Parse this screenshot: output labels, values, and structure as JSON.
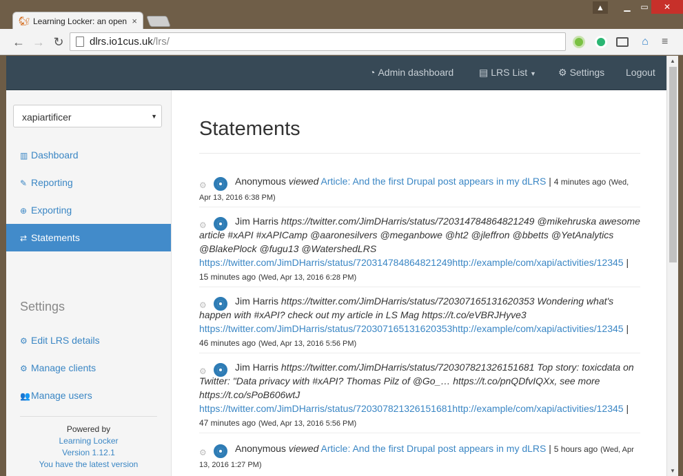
{
  "browser": {
    "tab_title": "Learning Locker: an open",
    "tab_close": "×",
    "url_host": "dlrs.io1cus.uk",
    "url_path": "/lrs/"
  },
  "topnav": {
    "admin": "Admin dashboard",
    "lrs_list": "LRS List",
    "settings": "Settings",
    "logout": "Logout"
  },
  "sidebar": {
    "select_value": "xapiartificer",
    "items": [
      {
        "label": "Dashboard"
      },
      {
        "label": "Reporting"
      },
      {
        "label": "Exporting"
      },
      {
        "label": "Statements"
      }
    ],
    "settings_heading": "Settings",
    "settings_items": [
      {
        "label": "Edit LRS details"
      },
      {
        "label": "Manage clients"
      },
      {
        "label": "Manage users"
      }
    ],
    "powered_by": "Powered by",
    "product": "Learning Locker",
    "version": "Version 1.12.1",
    "latest": "You have the latest version"
  },
  "main": {
    "title": "Statements",
    "statements": [
      {
        "actor": "Anonymous",
        "verb": "viewed",
        "object": "Article: And the first Drupal post appears in my dLRS",
        "ago": "4 minutes ago",
        "date": "(Wed, Apr 13, 2016 6:38 PM)"
      },
      {
        "actor": "Jim Harris",
        "text": "https://twitter.com/JimDHarris/status/720314784864821249 @mikehruska awesome article #xAPI #xAPICamp @aaronesilvers @meganbowe @ht2 @jleffron @bbetts @YetAnalytics @BlakePlock @fugu13 @WatershedLRS",
        "object": "https://twitter.com/JimDHarris/status/720314784864821249http://example/com/xapi/activities/12345",
        "ago": "15 minutes ago",
        "date": "(Wed, Apr 13, 2016 6:28 PM)"
      },
      {
        "actor": "Jim Harris",
        "text": "https://twitter.com/JimDHarris/status/720307165131620353 Wondering what's happen with #xAPI? check out my article in LS Mag https://t.co/eVBRJHyve3",
        "object": "https://twitter.com/JimDHarris/status/720307165131620353http://example/com/xapi/activities/12345",
        "ago": "46 minutes ago",
        "date": "(Wed, Apr 13, 2016 5:56 PM)"
      },
      {
        "actor": "Jim Harris",
        "text": "https://twitter.com/JimDHarris/status/720307821326151681 Top story: toxicdata on Twitter: \"Data privacy with #xAPI? Thomas Pilz of @Go_… https://t.co/pnQDfvIQXx, see more https://t.co/sPoB606wtJ",
        "object": "https://twitter.com/JimDHarris/status/720307821326151681http://example/com/xapi/activities/12345",
        "ago": "47 minutes ago",
        "date": "(Wed, Apr 13, 2016 5:56 PM)"
      },
      {
        "actor": "Anonymous",
        "verb": "viewed",
        "object": "Article: And the first Drupal post appears in my dLRS",
        "ago": "5 hours ago",
        "date": "(Wed, Apr 13, 2016 1:27 PM)"
      }
    ]
  },
  "colors": {
    "navbar": "#374956",
    "active": "#428bca",
    "link": "#3a86c4"
  }
}
